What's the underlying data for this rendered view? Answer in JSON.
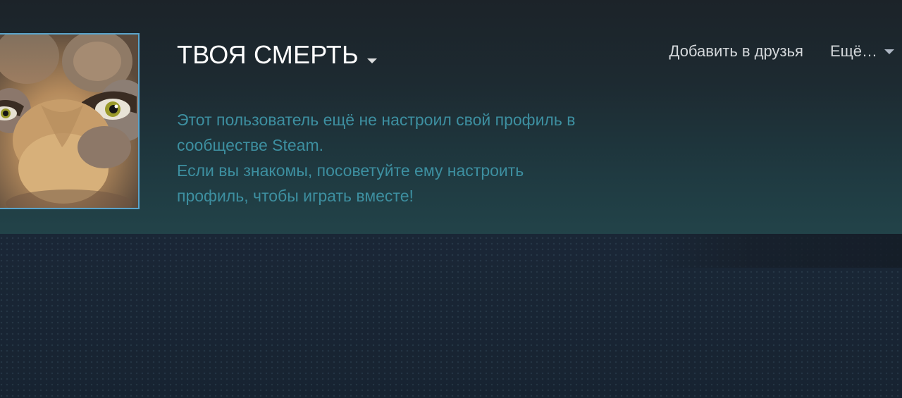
{
  "profile": {
    "persona_name": "ТВОЯ СМЕРТЬ",
    "avatar_icon": "user-avatar-icon",
    "private_message_lines": [
      "Этот пользователь ещё не настроил свой профиль в",
      "сообществе Steam.",
      "Если вы знакомы, посоветуйте ему настроить",
      "профиль, чтобы играть вместе!"
    ]
  },
  "actions": {
    "add_friend_label": "Добавить в друзья",
    "more_label": "Ещё…"
  },
  "colors": {
    "background": "#1b2838",
    "header_gradient_top": "#1c2329",
    "header_gradient_bottom": "#224349",
    "private_text": "#3d8fa0",
    "avatar_border": "#5aa4cb",
    "name_text": "#ffffff",
    "action_text": "#d4d8db"
  }
}
